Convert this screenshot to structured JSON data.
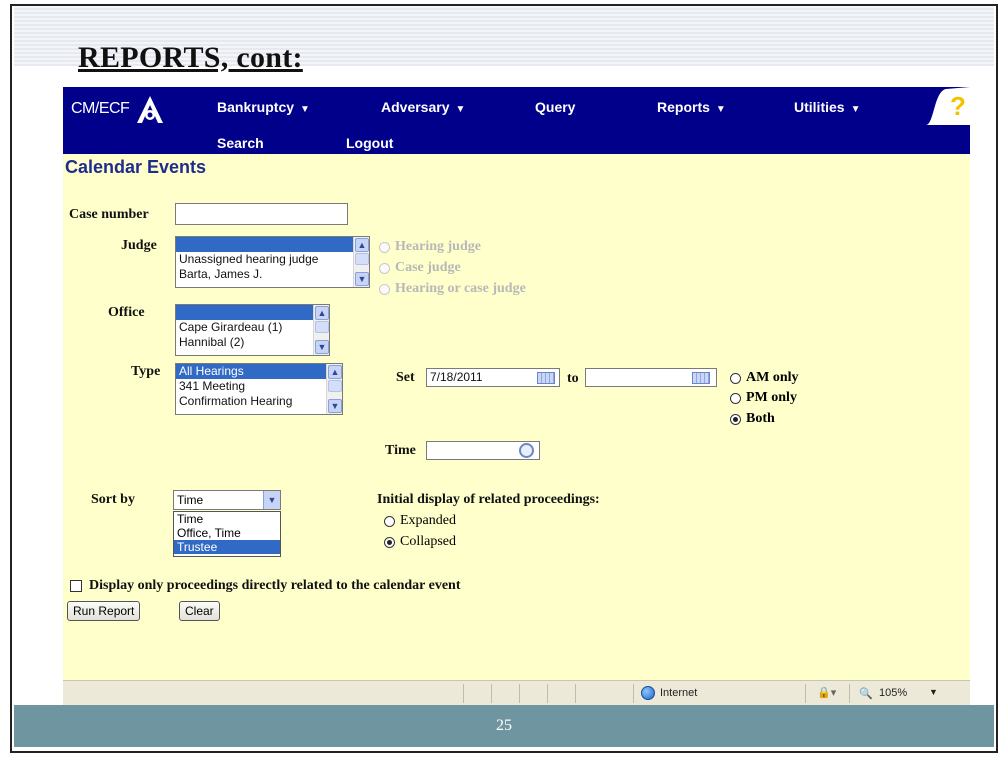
{
  "slide": {
    "title": "REPORTS, cont:",
    "page_number": "25"
  },
  "nav": {
    "logo_text": "CM/ECF",
    "items": [
      {
        "label": "Bankruptcy",
        "has_menu": true
      },
      {
        "label": "Adversary",
        "has_menu": true
      },
      {
        "label": "Query",
        "has_menu": false
      },
      {
        "label": "Reports",
        "has_menu": true
      },
      {
        "label": "Utilities",
        "has_menu": true
      }
    ],
    "row2": [
      "Search",
      "Logout"
    ],
    "help_icon": "question-mark-icon",
    "caret": "▼"
  },
  "page_heading": "Calendar Events",
  "form": {
    "case_number": {
      "label": "Case number",
      "value": ""
    },
    "judge": {
      "label": "Judge",
      "options": [
        "",
        "Unassigned hearing judge",
        "Barta, James J."
      ],
      "selected_index": 0,
      "radios": [
        "Hearing judge",
        "Case judge",
        "Hearing or case judge"
      ]
    },
    "office": {
      "label": "Office",
      "options": [
        "",
        "Cape Girardeau (1)",
        "Hannibal (2)"
      ],
      "selected_index": 0
    },
    "type": {
      "label": "Type",
      "options": [
        "All Hearings",
        "341 Meeting",
        "Confirmation Hearing"
      ],
      "selected_index": 0
    },
    "set": {
      "label": "Set",
      "from": "7/18/2011",
      "to_label": "to",
      "to": ""
    },
    "period": {
      "options": [
        "AM only",
        "PM only",
        "Both"
      ],
      "selected": "Both"
    },
    "time": {
      "label": "Time",
      "value": ""
    },
    "sort_by": {
      "label": "Sort by",
      "value": "Time",
      "options": [
        "Time",
        "Office, Time",
        "Trustee"
      ],
      "highlighted": "Trustee"
    },
    "related": {
      "label": "Initial display of related proceedings:",
      "options": [
        "Expanded",
        "Collapsed"
      ],
      "selected": "Collapsed"
    },
    "only_related": {
      "label": "Display only proceedings directly related to the calendar event",
      "checked": false
    },
    "buttons": {
      "run": "Run Report",
      "clear": "Clear"
    }
  },
  "statusbar": {
    "zone": "Internet",
    "zoom": "105%"
  }
}
